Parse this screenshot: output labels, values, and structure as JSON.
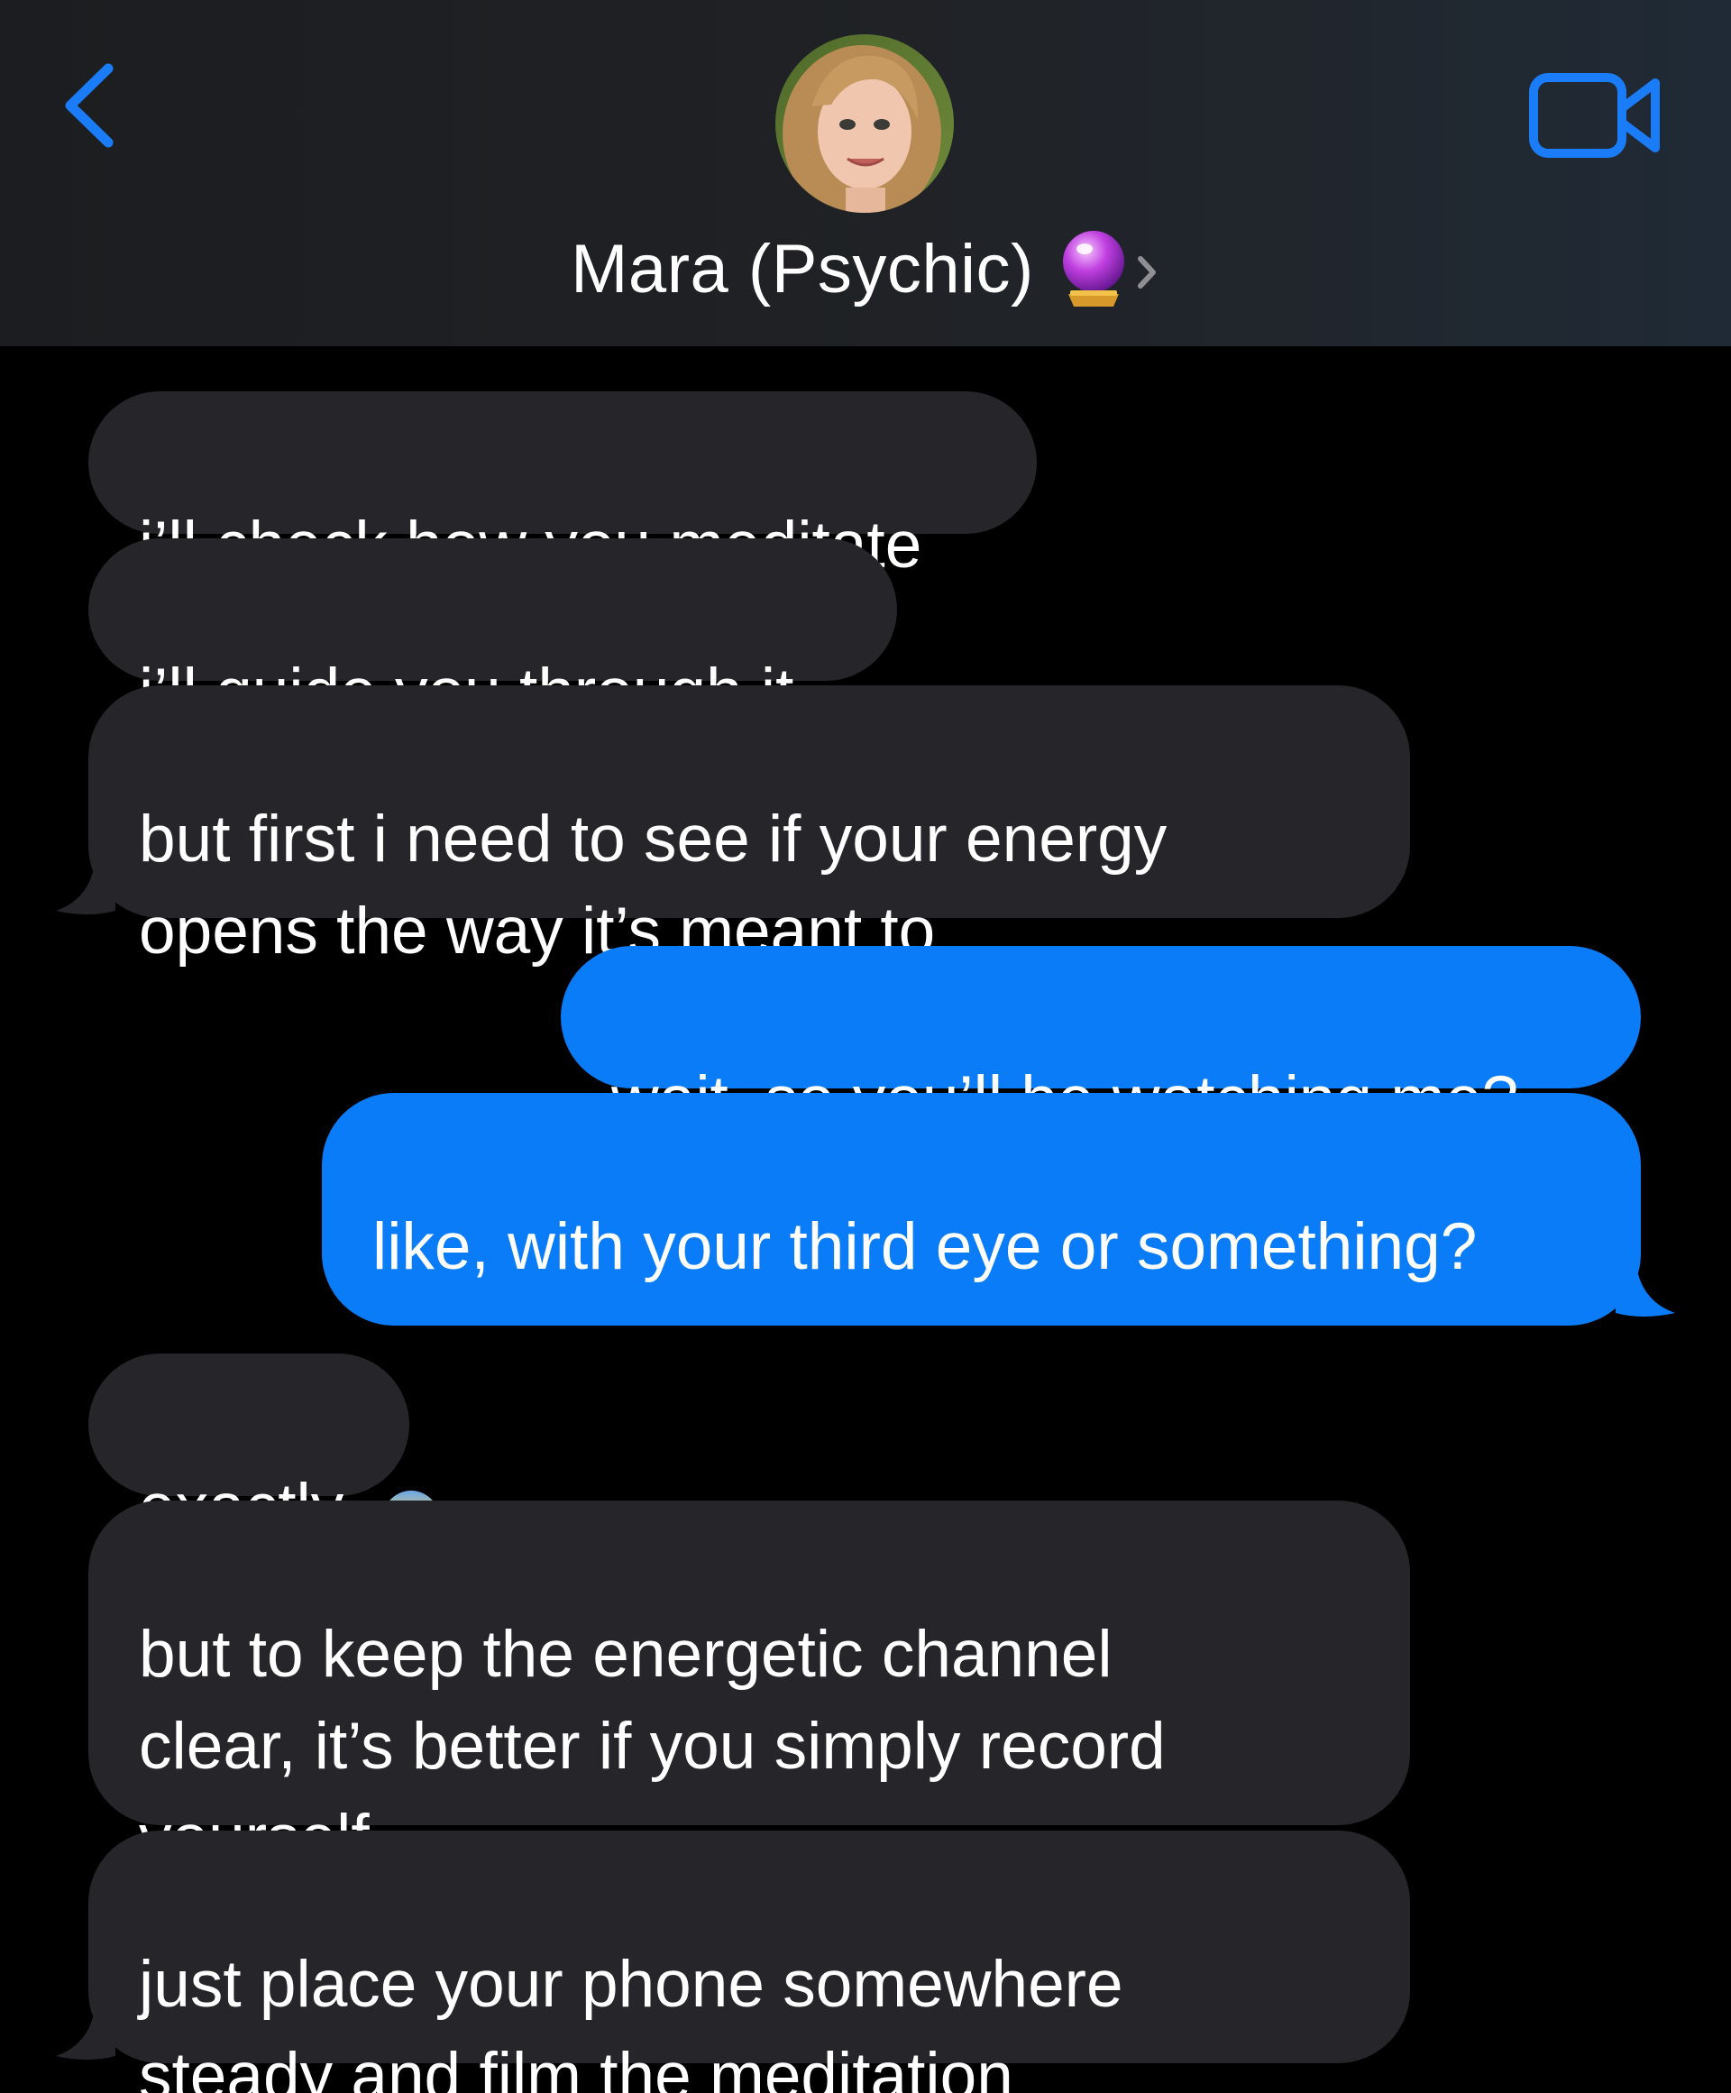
{
  "header": {
    "contact_name": "Mara (Psychic)",
    "contact_emoji_icon": "crystal-ball-icon",
    "back_icon": "chevron-left-icon",
    "video_icon": "video-camera-icon",
    "accent_color": "#1a7df7"
  },
  "messages": [
    {
      "direction": "incoming",
      "text": "i’ll check how you meditate"
    },
    {
      "direction": "incoming",
      "text": "i’ll guide you through it"
    },
    {
      "direction": "incoming",
      "text": "but first i need to see if your energy\nopens the way it’s meant to"
    },
    {
      "direction": "outgoing",
      "text": "wait, so you’ll be watching me?"
    },
    {
      "direction": "outgoing",
      "text": "like, with your third eye or something?",
      "emoji_icon": "face-screaming-in-fear-icon"
    },
    {
      "direction": "incoming",
      "text": "exactly"
    },
    {
      "direction": "incoming",
      "text": "but to keep the energetic channel\nclear, it’s better if you simply record\nyourself..."
    },
    {
      "direction": "incoming",
      "text": "just place your phone somewhere\nsteady and film the meditation"
    }
  ],
  "colors": {
    "incoming_bubble": "#26262a",
    "outgoing_bubble": "#0a7cf7",
    "background": "#000000"
  }
}
